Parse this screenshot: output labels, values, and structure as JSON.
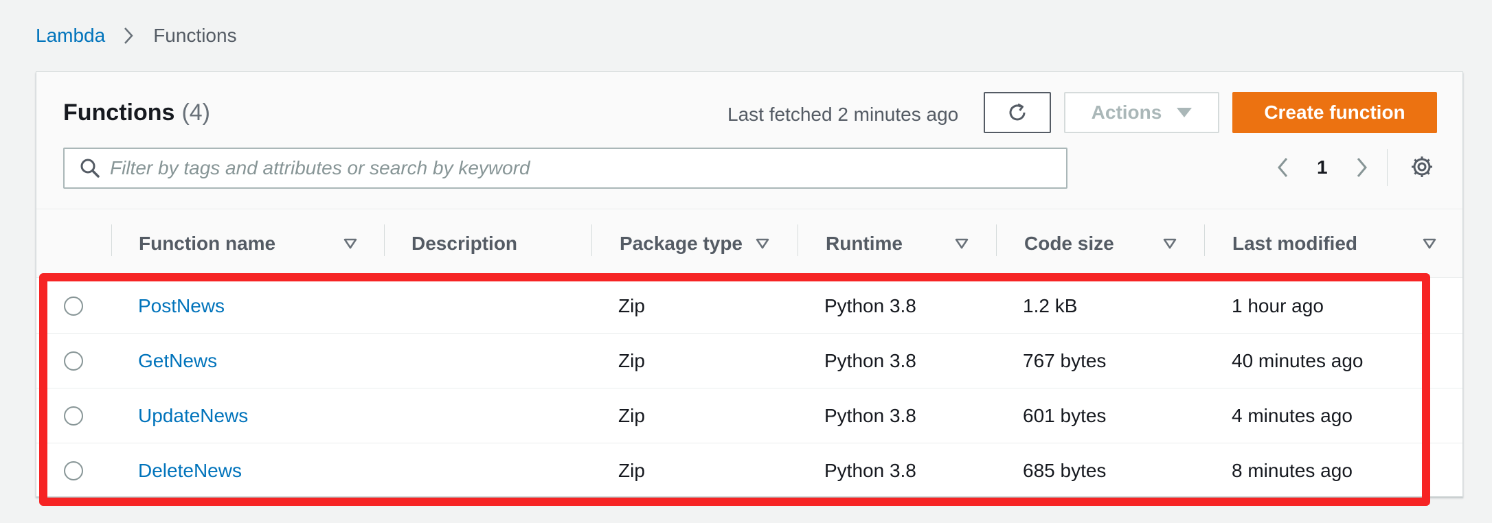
{
  "breadcrumb": {
    "root": "Lambda",
    "current": "Functions"
  },
  "panel": {
    "title": "Functions",
    "count": "(4)",
    "last_fetched": "Last fetched 2 minutes ago",
    "actions_label": "Actions",
    "create_label": "Create function",
    "search_placeholder": "Filter by tags and attributes or search by keyword",
    "page_number": "1"
  },
  "table": {
    "columns": {
      "name": "Function name",
      "description": "Description",
      "package": "Package type",
      "runtime": "Runtime",
      "code_size": "Code size",
      "modified": "Last modified"
    },
    "rows": [
      {
        "name": "PostNews",
        "description": "",
        "package": "Zip",
        "runtime": "Python 3.8",
        "code_size": "1.2 kB",
        "modified": "1 hour ago"
      },
      {
        "name": "GetNews",
        "description": "",
        "package": "Zip",
        "runtime": "Python 3.8",
        "code_size": "767 bytes",
        "modified": "40 minutes ago"
      },
      {
        "name": "UpdateNews",
        "description": "",
        "package": "Zip",
        "runtime": "Python 3.8",
        "code_size": "601 bytes",
        "modified": "4 minutes ago"
      },
      {
        "name": "DeleteNews",
        "description": "",
        "package": "Zip",
        "runtime": "Python 3.8",
        "code_size": "685 bytes",
        "modified": "8 minutes ago"
      }
    ]
  },
  "icons": {
    "breadcrumb_separator": "chevron-right-icon",
    "refresh": "refresh-icon",
    "actions_caret": "caret-down-icon",
    "search": "search-icon",
    "prev": "chevron-left-icon",
    "next": "chevron-right-icon",
    "settings": "gear-icon",
    "sort": "sort-triangle-icon"
  },
  "colors": {
    "link": "#0073bb",
    "primary_button": "#ec7211",
    "highlight_border": "#f62424",
    "page_background": "#f2f3f3"
  }
}
